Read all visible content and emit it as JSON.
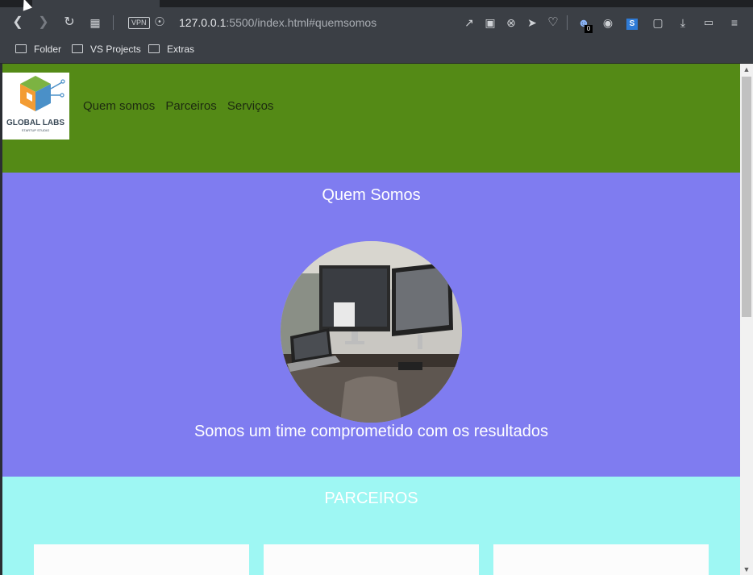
{
  "browser": {
    "url_host": "127.0.0.1",
    "url_rest": ":5500/index.html#quemsomos",
    "vpn_label": "VPN",
    "notification_badge": "0",
    "bookmarks": [
      {
        "label": "Folder"
      },
      {
        "label": "VS Projects"
      },
      {
        "label": "Extras"
      }
    ]
  },
  "site": {
    "logo": {
      "title": "GLOBAL LABS",
      "subtitle": "STARTUP STUDIO"
    },
    "nav": [
      {
        "label": "Quem somos"
      },
      {
        "label": "Parceiros"
      },
      {
        "label": "Serviços"
      }
    ],
    "quem_somos": {
      "heading": "Quem Somos",
      "text": "Somos um time comprometido com os resultados"
    },
    "parceiros": {
      "heading": "PARCEIROS"
    }
  },
  "colors": {
    "header_bg": "#548a16",
    "quem_bg": "#7f7cf0",
    "parceiros_bg": "#9ef7f3",
    "browser_chrome": "#3b3f45"
  }
}
